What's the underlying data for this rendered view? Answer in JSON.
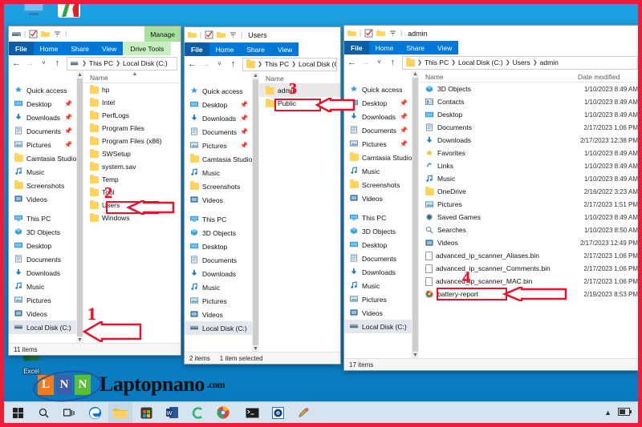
{
  "desktop": {
    "icons": [
      {
        "name": "this-pc",
        "label": ""
      },
      {
        "name": "paint-app",
        "label": ""
      },
      {
        "name": "excel",
        "label": "Excel"
      }
    ]
  },
  "watermark": {
    "tiles": [
      "L",
      "N",
      "N"
    ],
    "brand": "Laptopnano",
    "suffix": ".com",
    "colors": {
      "orange": "#f07c1f",
      "blue": "#3b5fa8",
      "green": "#5bbd3b",
      "ring": "#2255a4"
    }
  },
  "annotations": {
    "numbers": [
      "1",
      "2",
      "3",
      "4"
    ],
    "color": "#e8102b"
  },
  "nav_pane": {
    "quick_access_label": "Quick access",
    "quick_access": [
      {
        "label": "Desktop",
        "icon": "desktop-icon",
        "pinned": true
      },
      {
        "label": "Downloads",
        "icon": "downloads-icon",
        "pinned": true
      },
      {
        "label": "Documents",
        "icon": "documents-icon",
        "pinned": true
      },
      {
        "label": "Pictures",
        "icon": "pictures-icon",
        "pinned": true
      },
      {
        "label": "Camtasia Studio",
        "icon": "folder-icon",
        "pinned": false
      },
      {
        "label": "Music",
        "icon": "music-icon",
        "pinned": false
      },
      {
        "label": "Screenshots",
        "icon": "folder-icon",
        "pinned": false
      },
      {
        "label": "Videos",
        "icon": "videos-icon",
        "pinned": false
      }
    ],
    "this_pc_label": "This PC",
    "this_pc": [
      {
        "label": "3D Objects",
        "icon": "3d-objects-icon"
      },
      {
        "label": "Desktop",
        "icon": "desktop-icon"
      },
      {
        "label": "Documents",
        "icon": "documents-icon"
      },
      {
        "label": "Downloads",
        "icon": "downloads-icon"
      },
      {
        "label": "Music",
        "icon": "music-icon"
      },
      {
        "label": "Pictures",
        "icon": "pictures-icon"
      },
      {
        "label": "Videos",
        "icon": "videos-icon"
      },
      {
        "label": "Local Disk (C:)",
        "icon": "drive-icon"
      }
    ]
  },
  "ribbon_tabs": [
    "File",
    "Home",
    "Share",
    "View"
  ],
  "window1": {
    "title": "",
    "contextual_tab": "Manage",
    "contextual_group": "Drive Tools",
    "breadcrumb": [
      "This PC",
      "Local Disk (C:)"
    ],
    "column_name": "Name",
    "items": [
      {
        "label": "hp"
      },
      {
        "label": "Intel"
      },
      {
        "label": "PerfLogs"
      },
      {
        "label": "Program Files"
      },
      {
        "label": "Program Files (x86)"
      },
      {
        "label": "SWSetup"
      },
      {
        "label": "system.sav"
      },
      {
        "label": "Temp"
      },
      {
        "label": "Tool"
      },
      {
        "label": "Users"
      },
      {
        "label": "Windows"
      }
    ],
    "status": "11 items"
  },
  "window2": {
    "title": "Users",
    "breadcrumb": [
      "This PC",
      "Local Disk (C:)"
    ],
    "column_name": "Name",
    "items": [
      {
        "label": "admin",
        "selected": true
      },
      {
        "label": "Public",
        "selected": false
      }
    ],
    "status_count": "2 items",
    "status_selected": "1 item selected"
  },
  "window3": {
    "title": "admin",
    "breadcrumb": [
      "This PC",
      "Local Disk (C:)",
      "Users",
      "admin"
    ],
    "column_name": "Name",
    "column_date": "Date modified",
    "items": [
      {
        "label": "3D Objects",
        "date": "1/10/2023 8:49 AM",
        "icon": "3d-objects-icon"
      },
      {
        "label": "Contacts",
        "date": "1/10/2023 8:49 AM",
        "icon": "contacts-icon"
      },
      {
        "label": "Desktop",
        "date": "1/10/2023 8:49 AM",
        "icon": "desktop-icon"
      },
      {
        "label": "Documents",
        "date": "2/17/2023 1:06 PM",
        "icon": "documents-icon"
      },
      {
        "label": "Downloads",
        "date": "2/17/2023 12:38 PM",
        "icon": "downloads-icon"
      },
      {
        "label": "Favorites",
        "date": "1/10/2023 8:49 AM",
        "icon": "favorites-icon"
      },
      {
        "label": "Links",
        "date": "1/10/2023 8:49 AM",
        "icon": "links-icon"
      },
      {
        "label": "Music",
        "date": "1/10/2023 8:49 AM",
        "icon": "music-icon"
      },
      {
        "label": "OneDrive",
        "date": "2/16/2022 3:23 AM",
        "icon": "folder-icon"
      },
      {
        "label": "Pictures",
        "date": "2/17/2023 1:51 PM",
        "icon": "pictures-icon"
      },
      {
        "label": "Saved Games",
        "date": "1/10/2023 8:49 AM",
        "icon": "saved-games-icon"
      },
      {
        "label": "Searches",
        "date": "1/10/2023 8:50 AM",
        "icon": "searches-icon"
      },
      {
        "label": "Videos",
        "date": "2/17/2023 12:49 PM",
        "icon": "videos-icon"
      },
      {
        "label": "advanced_ip_scanner_Aliases.bin",
        "date": "2/17/2023 1:06 PM",
        "icon": "file-icon"
      },
      {
        "label": "advanced_ip_scanner_Comments.bin",
        "date": "2/17/2023 1:06 PM",
        "icon": "file-icon"
      },
      {
        "label": "advanced_ip_scanner_MAC.bin",
        "date": "2/17/2023 1:06 PM",
        "icon": "file-icon"
      },
      {
        "label": "battery-report",
        "date": "2/19/2023 8:53 PM",
        "icon": "chrome-icon"
      }
    ],
    "status": "17 items"
  },
  "taskbar": {
    "items": [
      {
        "name": "start-button",
        "icon": "windows-logo"
      },
      {
        "name": "search-button",
        "icon": "search-icon"
      },
      {
        "name": "task-view-button",
        "icon": "task-view-icon"
      },
      {
        "name": "edge-button",
        "icon": "edge-icon"
      },
      {
        "name": "file-explorer-button",
        "icon": "folder-icon"
      },
      {
        "name": "store-button",
        "icon": "store-icon"
      },
      {
        "name": "word-button",
        "icon": "word-icon"
      },
      {
        "name": "cmd-alt-button",
        "icon": "c-app-icon"
      },
      {
        "name": "chrome-button",
        "icon": "chrome-icon"
      },
      {
        "name": "terminal-button",
        "icon": "terminal-icon"
      },
      {
        "name": "media-button",
        "icon": "disc-icon"
      },
      {
        "name": "paint-button",
        "icon": "paint-icon"
      }
    ],
    "tray": [
      "show-hidden-icons",
      "battery-icon"
    ]
  }
}
